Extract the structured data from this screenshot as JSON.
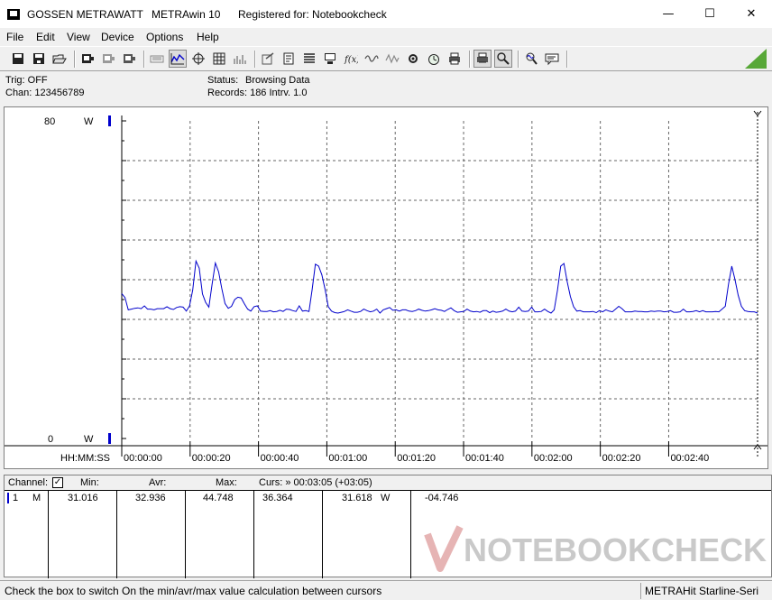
{
  "titlebar": {
    "brand": "GOSSEN METRAWATT",
    "product": "METRAwin 10",
    "registered": "Registered for: Notebookcheck",
    "minimize": "—",
    "maximize": "☐",
    "close": "✕"
  },
  "menu": [
    "File",
    "Edit",
    "View",
    "Device",
    "Options",
    "Help"
  ],
  "toolbar_icons": [
    "save-icon",
    "save-as-icon",
    "open-folder-icon",
    "device-icon",
    "device-read-icon",
    "device-write-icon",
    "keyboard-icon",
    "chart-view-icon",
    "crosshair-icon",
    "table-view-icon",
    "histogram-icon",
    "export-icon",
    "print-preview-icon",
    "list-icon",
    "computer-icon",
    "formula-icon",
    "wave-icon",
    "signal-icon",
    "settings-icon",
    "clock-icon",
    "printer-icon",
    "printer-setup-icon",
    "zoom-in-icon",
    "zoom-wave-icon",
    "comment-icon"
  ],
  "status": {
    "trig": "Trig: OFF",
    "chan": "Chan:  123456789",
    "status_label": "Status:",
    "status_value": "Browsing Data",
    "records": "Records: 186  Intrv. 1.0"
  },
  "chart_data": {
    "type": "line",
    "ylim": [
      0,
      80
    ],
    "y_top_label": "80",
    "y_bottom_label": "0",
    "y_unit_top": "W",
    "y_unit_bottom": "W",
    "xlabel": "HH:MM:SS",
    "x_range_seconds": [
      0,
      186
    ],
    "x_ticks": [
      "00:00:00",
      "00:00:20",
      "00:00:40",
      "00:01:00",
      "00:01:20",
      "00:01:40",
      "00:02:00",
      "00:02:20",
      "00:02:40"
    ],
    "y_grid_divisions": 8,
    "y_minor_ticks": 16,
    "line_color": "#0000cc",
    "grid": "dashed",
    "series": [
      {
        "values": [
          36.5,
          35.5,
          32.4,
          32.6,
          32.8,
          32.9,
          32.7,
          33.4,
          32.6,
          32.6,
          32.4,
          32.7,
          32.7,
          32.7,
          33.2,
          32.7,
          32.5,
          33.0,
          33.2,
          33.1,
          32.1,
          33.4,
          37.4,
          44.7,
          42.9,
          36.4,
          34.3,
          33.1,
          38.9,
          44.2,
          42.0,
          37.8,
          34.0,
          32.8,
          33.3,
          35.0,
          35.6,
          35.4,
          33.9,
          32.6,
          32.1,
          33.2,
          33.4,
          32.1,
          32.0,
          32.0,
          32.2,
          31.9,
          32.0,
          32.3,
          32.0,
          32.6,
          32.5,
          32.2,
          32.0,
          33.4,
          32.1,
          32.2,
          32.0,
          37.5,
          43.9,
          43.4,
          41.2,
          37.5,
          33.2,
          32.1,
          31.7,
          31.6,
          31.8,
          32.0,
          32.4,
          32.1,
          31.8,
          31.8,
          32.0,
          32.6,
          32.2,
          31.9,
          32.1,
          32.6,
          31.6,
          32.4,
          32.7,
          33.0,
          32.3,
          32.4,
          32.1,
          32.4,
          32.4,
          32.1,
          32.0,
          32.2,
          32.6,
          32.3,
          32.1,
          32.2,
          32.4,
          32.7,
          32.4,
          32.3,
          32.0,
          32.5,
          32.9,
          32.2,
          31.8,
          31.9,
          32.0,
          32.6,
          32.1,
          31.9,
          32.0,
          31.8,
          32.2,
          32.2,
          31.7,
          32.1,
          31.8,
          31.9,
          32.1,
          32.6,
          32.1,
          31.9,
          32.1,
          33.1,
          32.1,
          32.0,
          32.1,
          33.1,
          31.9,
          31.9,
          32.0,
          32.6,
          32.0,
          31.6,
          32.4,
          37.3,
          43.4,
          44.1,
          39.5,
          35.8,
          33.2,
          32.1,
          32.2,
          31.9,
          31.9,
          31.9,
          32.0,
          31.7,
          32.2,
          31.9,
          32.4,
          32.1,
          31.9,
          32.6,
          33.3,
          32.7,
          31.9,
          31.9,
          31.9,
          32.1,
          32.0,
          32.0,
          31.9,
          31.9,
          32.1,
          32.0,
          32.1,
          32.1,
          31.9,
          32.0,
          32.2,
          31.8,
          31.8,
          31.9,
          32.6,
          31.9,
          31.9,
          32.0,
          32.2,
          31.9,
          32.2,
          31.9,
          31.9,
          31.9,
          32.0,
          31.9,
          32.6,
          33.3,
          38.9,
          43.4,
          40.1,
          36.1,
          33.3,
          32.2,
          32.0,
          31.9,
          31.9,
          31.6
        ]
      }
    ]
  },
  "table": {
    "header": {
      "channel": "Channel:",
      "checked": "✓",
      "min": "Min:",
      "avr": "Avr:",
      "max": "Max:",
      "curs": "Curs: » 00:03:05 (+03:05)"
    },
    "row": {
      "num": "1",
      "mode": "M",
      "min": "31.016",
      "avr": "32.936",
      "max": "44.748",
      "c1": "36.364",
      "c2": "31.618",
      "unit": "W",
      "diff": "-04.746"
    }
  },
  "watermark": "NOTEBOOKCHECK",
  "statusbar": {
    "hint": "Check the box to switch On the min/avr/max value calculation between cursors",
    "device": "METRAHit Starline-Seri"
  }
}
